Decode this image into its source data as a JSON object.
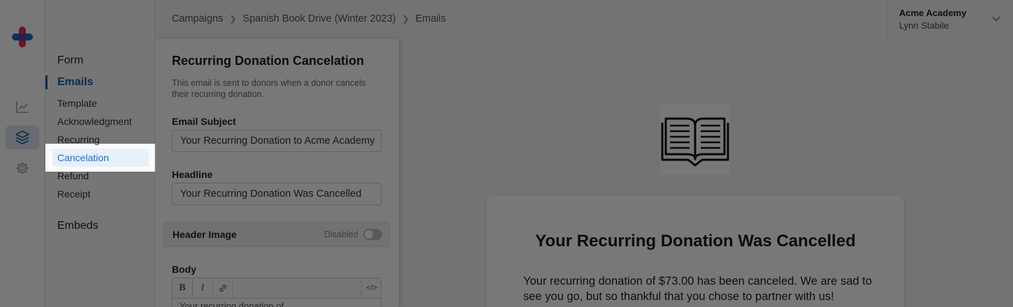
{
  "colors": {
    "accent": "#1f5fa8",
    "logo_red": "#e0334d",
    "logo_blue": "#1c66c4"
  },
  "rail": {
    "icons": [
      "app-logo",
      "trending-chart-icon",
      "layers-icon",
      "gear-icon"
    ]
  },
  "subnav": {
    "form": "Form",
    "emails": "Emails",
    "template": "Template",
    "acknowledgment": "Acknowledgment",
    "recurring": "Recurring",
    "cancelation": "Cancelation",
    "refund": "Refund",
    "receipt": "Receipt",
    "embeds": "Embeds"
  },
  "breadcrumb": {
    "items": [
      "Campaigns",
      "Spanish Book Drive (Winter 2023)",
      "Emails"
    ]
  },
  "account": {
    "org": "Acme Academy",
    "user": "Lynn Stabile"
  },
  "editor": {
    "title": "Recurring Donation Cancelation",
    "description": "This email is sent to donors when a donor cancels their recurring donation.",
    "subject_label": "Email Subject",
    "subject_value": "Your Recurring Donation to Acme Academy",
    "headline_label": "Headline",
    "headline_value": "Your Recurring Donation Was Cancelled",
    "header_image_label": "Header Image",
    "header_image_status": "Disabled",
    "header_image_enabled": false,
    "body_label": "Body",
    "toolbar": {
      "bold": "B",
      "italic": "I",
      "code": "</>"
    },
    "body_preview": "Your recurring donation of"
  },
  "preview": {
    "headline": "Your Recurring Donation Was Cancelled",
    "body": "Your recurring donation of $73.00 has been canceled. We are sad to see you go, but so thankful that you chose to partner with us!"
  }
}
